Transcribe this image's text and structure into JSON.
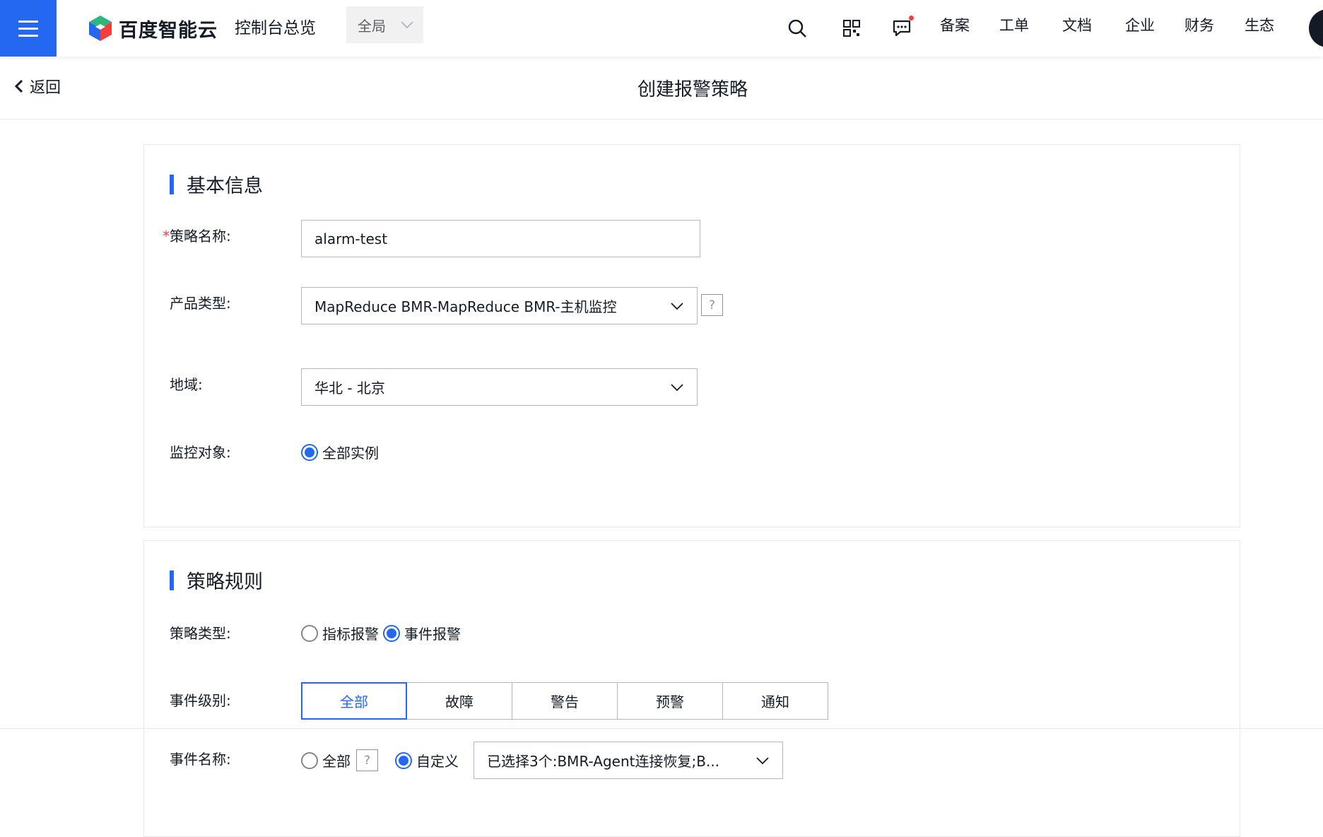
{
  "topbar": {
    "brand": "百度智能云",
    "console_title": "控制台总览",
    "region": "全局",
    "nav_links": [
      "备案",
      "工单",
      "文档",
      "企业",
      "财务",
      "生态"
    ]
  },
  "header": {
    "back_label": "返回",
    "title": "创建报警策略"
  },
  "basic": {
    "section_title": "基本信息",
    "name_label": "策略名称:",
    "name_value": "alarm-test",
    "product_label": "产品类型:",
    "product_value": "MapReduce BMR-MapReduce BMR-主机监控",
    "region_label": "地域:",
    "region_value": "华北 - 北京",
    "target_label": "监控对象:",
    "target_option": "全部实例"
  },
  "rule": {
    "section_title": "策略规则",
    "type_label": "策略类型:",
    "type_options": [
      "指标报警",
      "事件报警"
    ],
    "type_selected": "事件报警",
    "level_label": "事件级别:",
    "levels": [
      "全部",
      "故障",
      "警告",
      "预警",
      "通知"
    ],
    "level_selected": "全部",
    "event_name_label": "事件名称:",
    "event_name_all": "全部",
    "event_name_custom": "自定义",
    "event_name_value": "已选择3个:BMR-Agent连接恢复;B..."
  },
  "help_symbol": "?",
  "colors": {
    "accent": "#2468f2",
    "required": "#f33e3e",
    "text": "#151b26",
    "border": "#b8babf"
  }
}
